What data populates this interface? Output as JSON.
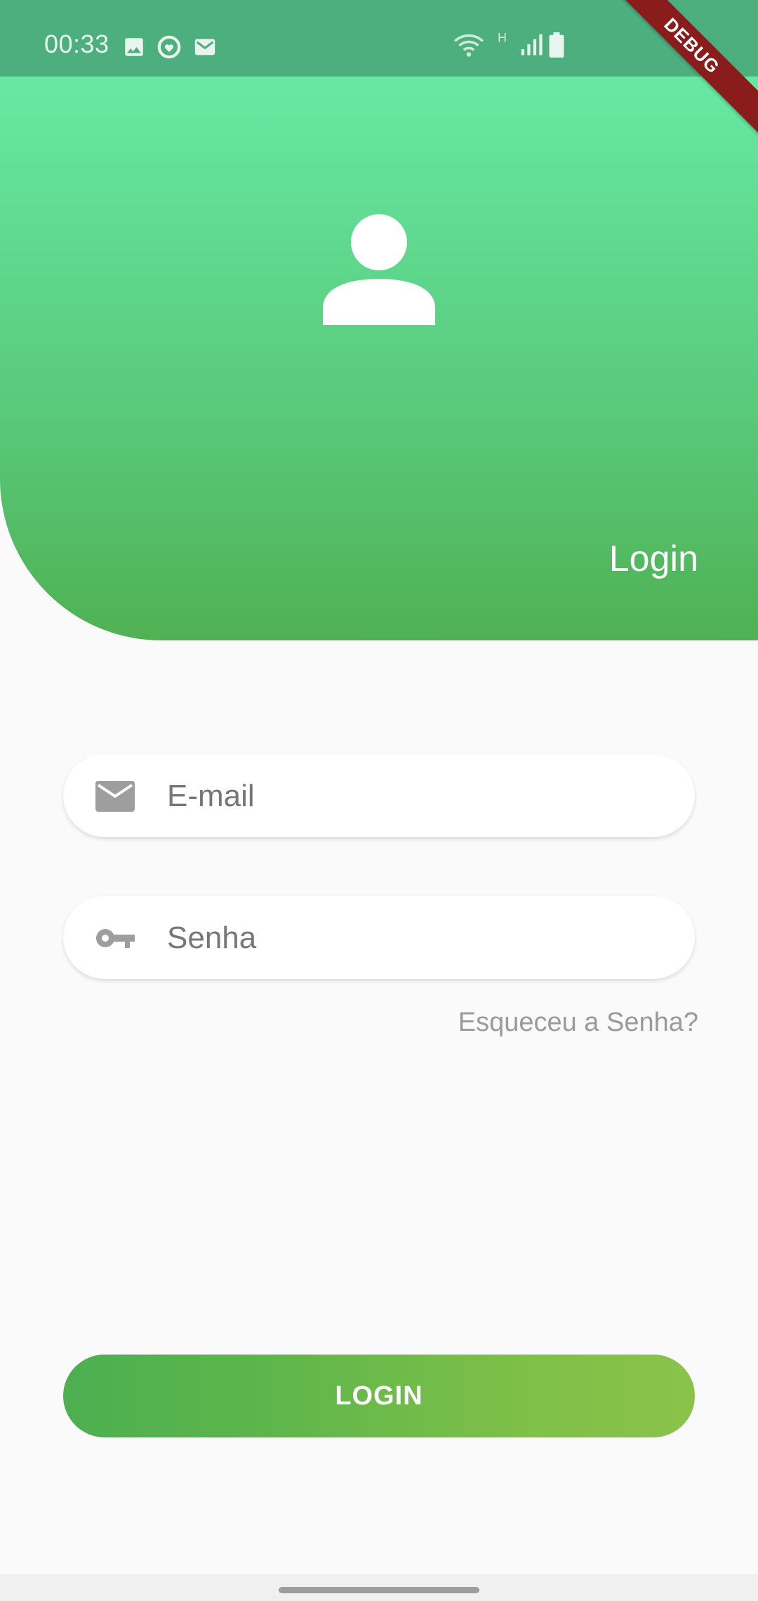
{
  "status_bar": {
    "time": "00:33",
    "network_label": "H",
    "icons": [
      "image-icon",
      "shield-heart-icon",
      "mail-icon",
      "wifi-icon",
      "signal-icon",
      "battery-icon"
    ]
  },
  "debug_banner": "DEBUG",
  "header": {
    "title": "Login",
    "avatar_icon": "person-icon"
  },
  "form": {
    "email": {
      "placeholder": "E-mail",
      "value": ""
    },
    "password": {
      "placeholder": "Senha",
      "value": ""
    },
    "forgot_label": "Esqueceu a Senha?"
  },
  "login_button": "LOGIN",
  "colors": {
    "header_top": "#66e9a3",
    "header_bottom": "#4fb153",
    "button_start": "#4caf50",
    "button_end": "#8bc34a",
    "status_bar": "#4caf7d"
  }
}
